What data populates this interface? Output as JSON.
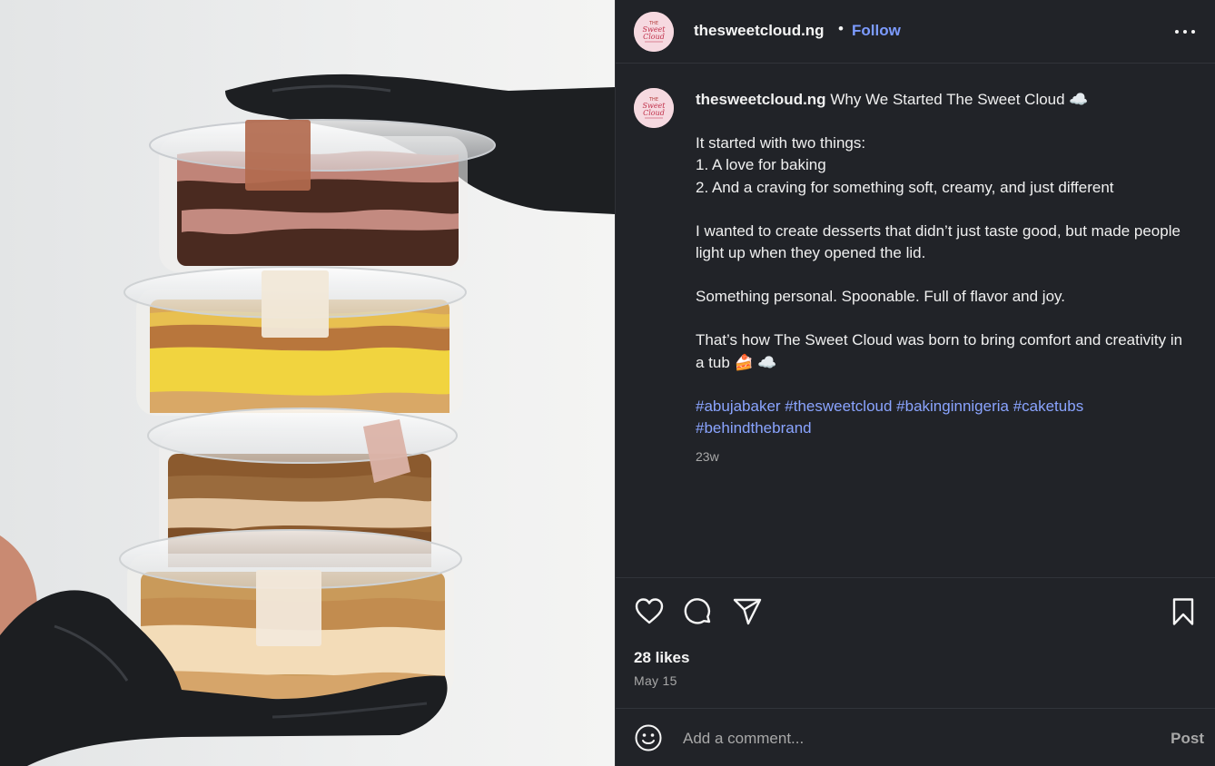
{
  "post": {
    "account": {
      "handle": "thesweetcloud.ng",
      "separator": "•",
      "follow_label": "Follow",
      "avatar_text": "Sweet Cloud"
    },
    "caption": {
      "handle": "thesweetcloud.ng",
      "title": "Why We Started The Sweet Cloud ☁️",
      "lines": [
        "It started with two things:",
        "1. A love for baking",
        "2. And a craving for something soft, creamy, and just different",
        "I wanted to create desserts that didn’t just taste good, but made people light up when they opened the lid.",
        "Something personal. Spoonable. Full of flavor and joy.",
        "That’s how The Sweet Cloud was born to bring comfort and creativity in a tub 🍰 ☁️"
      ],
      "hashtags": "#abujabaker #thesweetcloud #bakinginnigeria #caketubs #behindthebrand",
      "age": "23w"
    },
    "likes": "28 likes",
    "date": "May 15",
    "comment_placeholder": "Add a comment...",
    "post_label": "Post",
    "icons": {
      "more": "more-options-icon",
      "like": "heart-icon",
      "comment": "comment-bubble-icon",
      "share": "share-paper-plane-icon",
      "save": "bookmark-icon",
      "emoji": "smiley-emoji-icon"
    },
    "colors": {
      "panel_bg": "#212328",
      "link": "#7c9bff",
      "hashtag": "#8aa4ff",
      "muted": "#a8a8a8",
      "avatar_bg": "#f6d9e0"
    }
  }
}
